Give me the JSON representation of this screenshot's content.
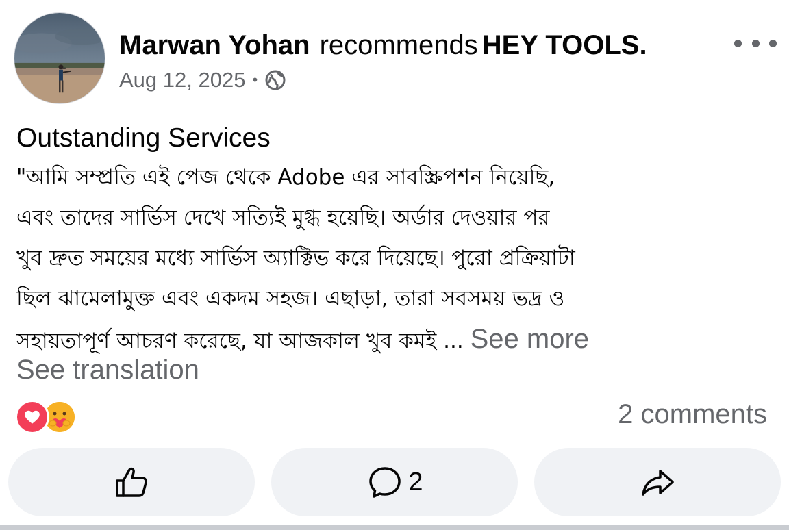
{
  "post": {
    "author": "Marwan Yohan",
    "action": "recommends",
    "page_name": "HEY TOOLS.",
    "date": "Aug 12, 2025",
    "separator": "•",
    "privacy_icon": "globe-icon",
    "title": "Outstanding Services",
    "body_lines": [
      "\"আমি সম্প্রতি এই পেজ থেকে Adobe এর সাবস্ক্রিপশন নিয়েছি,",
      "এবং তাদের সার্ভিস দেখে সত্যিই মুগ্ধ হয়েছি। অর্ডার দেওয়ার পর",
      "খুব দ্রুত সময়ের মধ্যে সার্ভিস অ্যাক্টিভ করে দিয়েছে। পুরো প্রক্রিয়াটা",
      "ছিল ঝামেলামুক্ত এবং একদম সহজ। এছাড়া, তারা সবসময় ভদ্র ও",
      "সহায়তাপূর্ণ আচরণ করেছে, যা আজকাল খুব কমই ..."
    ],
    "see_more": "See more",
    "see_translation": "See translation"
  },
  "reactions": {
    "icons": [
      "love-reaction-icon",
      "care-reaction-icon"
    ],
    "comments_label": "2 comments"
  },
  "actions": {
    "like_icon": "thumbs-up-icon",
    "comment_icon": "comment-bubble-icon",
    "comment_count": "2",
    "share_icon": "share-arrow-icon"
  },
  "colors": {
    "text_primary": "#050505",
    "text_secondary": "#65676b",
    "button_bg": "#f0f2f5",
    "love": "#f33e58",
    "care": "#f7b125"
  }
}
